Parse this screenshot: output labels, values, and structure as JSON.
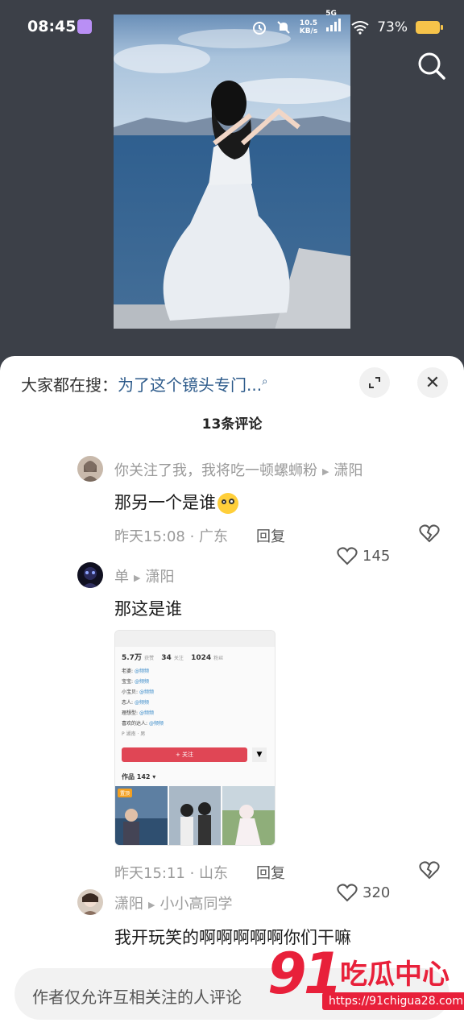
{
  "status_bar": {
    "time": "08:45",
    "net_speed_top": "10.5",
    "net_speed_bottom": "KB/s",
    "network": "5G",
    "battery": "73%",
    "icons": [
      "alarm-icon",
      "mute-icon",
      "signal-icon",
      "wifi-icon",
      "battery-icon"
    ]
  },
  "sheet": {
    "search_prefix": "大家都在搜：",
    "search_query": "为了这个镜头专门...",
    "comment_count": "13条评论",
    "close_symbol": "✕"
  },
  "comments": [
    {
      "author": "你关注了我，我将吃一顿螺蛳粉",
      "reply_to": "潇阳",
      "text": "那另一个是谁",
      "time_location": "昨天15:08 · 广东",
      "reply_label": "回复",
      "likes": "145"
    },
    {
      "author": "单",
      "reply_to": "潇阳",
      "text": "那这是谁",
      "time_location": "昨天15:11 · 山东",
      "reply_label": "回复",
      "likes": "320",
      "embedded_profile": {
        "likes_count": "5.7万",
        "likes_label": "获赞",
        "following_count": "34",
        "following_label": "关注",
        "fans_count": "1024",
        "fans_label": "粉丝",
        "rows": [
          "老婆:",
          "宝宝:",
          "小宝贝:",
          "恋人:",
          "理想型:",
          "喜欢的达人:"
        ],
        "tag": "@频频",
        "location_chip": "P 湖南 · 男",
        "follow_button": "+ 关注",
        "works_label": "作品 142 ▾",
        "thumb_tag": "置顶"
      }
    },
    {
      "author": "潇阳",
      "reply_to": "小小高同学",
      "text": "我开玩笑的啊啊啊啊啊你们干嘛"
    }
  ],
  "input": {
    "placeholder": "作者仅允许互相关注的人评论"
  },
  "watermark": {
    "number": "91",
    "title": "吃瓜中心",
    "url": "https://91chigua28.com"
  }
}
